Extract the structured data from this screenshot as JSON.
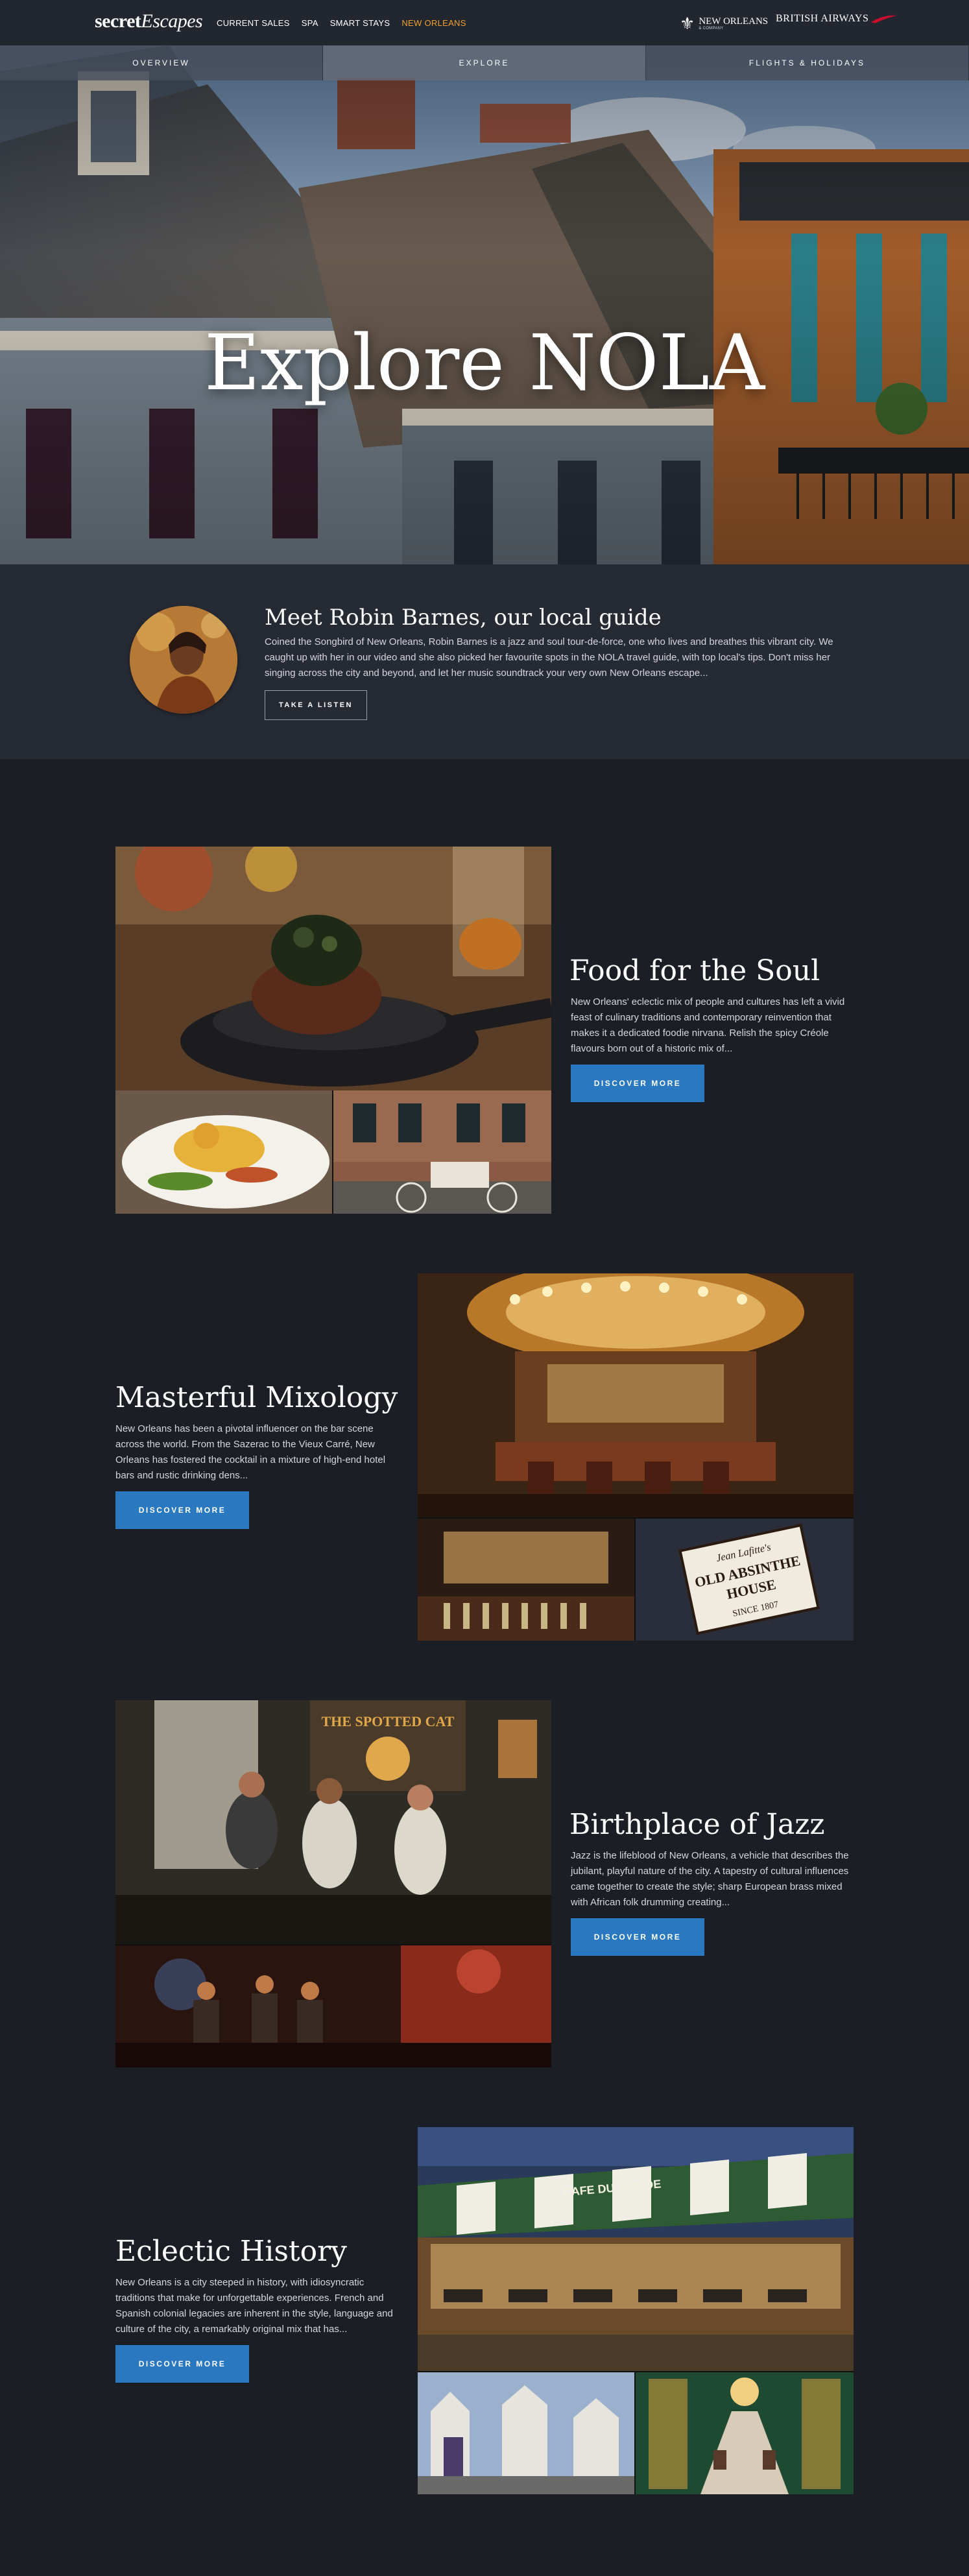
{
  "brand": {
    "name_bold": "secret",
    "name_script": "Escapes"
  },
  "nav": {
    "links": [
      "CURRENT SALES",
      "SPA",
      "SMART STAYS",
      "NEW ORLEANS"
    ]
  },
  "partners": {
    "nola_big": "NEW ORLEANS",
    "nola_small": "& COMPANY",
    "ba": "BRITISH AIRWAYS"
  },
  "tabs": [
    "OVERVIEW",
    "EXPLORE",
    "FLIGHTS & HOLIDAYS"
  ],
  "hero": {
    "title": "Explore NOLA"
  },
  "guide": {
    "title": "Meet Robin Barnes, our local guide",
    "body": "Coined the Songbird of New Orleans, Robin Barnes is a jazz and soul tour-de-force, one who lives and breathes this vibrant city. We caught up with her in our video and she also picked her favourite spots in the NOLA travel guide, with top local's tips. Don't miss her singing across the city and beyond, and let her music soundtrack your very own New Orleans escape...",
    "button": "TAKE A LISTEN"
  },
  "sections": [
    {
      "title": "Food for the Soul",
      "body": "New Orleans' eclectic mix of people and cultures has left a vivid feast of culinary traditions and contemporary reinvention that makes it a dedicated foodie nirvana. Relish the spicy Créole flavours born out of a historic mix of...",
      "button": "DISCOVER MORE"
    },
    {
      "title": "Masterful Mixology",
      "body": "New Orleans has been a pivotal influencer on the bar scene across the world. From the Sazerac to the Vieux Carré, New Orleans has fostered the cocktail in a mixture of high-end hotel bars and rustic drinking dens...",
      "button": "DISCOVER MORE",
      "sign": [
        "Jean Lafitte's",
        "OLD ABSINTHE",
        "HOUSE",
        "SINCE 1807"
      ]
    },
    {
      "title": "Birthplace of Jazz",
      "body": "Jazz is the lifeblood of New Orleans, a vehicle that describes the jubilant, playful nature of the city. A tapestry of cultural influences came together to create the style; sharp European brass mixed with African folk drumming creating...",
      "button": "DISCOVER MORE",
      "sign": "THE SPOTTED CAT"
    },
    {
      "title": "Eclectic History",
      "body": "New Orleans is a city steeped in history, with idiosyncratic traditions that make for unforgettable experiences. French and Spanish colonial legacies are inherent in the style, language and culture of the city, a remarkably original mix that has...",
      "button": "DISCOVER MORE",
      "sign": "CAFE DU MONDE"
    }
  ]
}
